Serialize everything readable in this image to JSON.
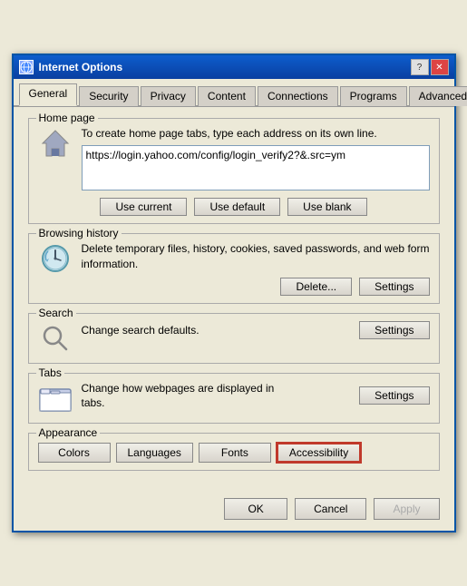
{
  "window": {
    "title": "Internet Options",
    "icon": "IE"
  },
  "tabs": [
    {
      "label": "General",
      "active": true
    },
    {
      "label": "Security",
      "active": false
    },
    {
      "label": "Privacy",
      "active": false
    },
    {
      "label": "Content",
      "active": false
    },
    {
      "label": "Connections",
      "active": false
    },
    {
      "label": "Programs",
      "active": false
    },
    {
      "label": "Advanced",
      "active": false
    }
  ],
  "sections": {
    "homepage": {
      "label": "Home page",
      "description": "To create home page tabs, type each address on its own line.",
      "url": "https://login.yahoo.com/config/login_verify2?&.src=ym",
      "buttons": {
        "use_current": "Use current",
        "use_default": "Use default",
        "use_blank": "Use blank"
      }
    },
    "browsing_history": {
      "label": "Browsing history",
      "description": "Delete temporary files, history, cookies, saved passwords, and web form information.",
      "buttons": {
        "delete": "Delete...",
        "settings": "Settings"
      }
    },
    "search": {
      "label": "Search",
      "description": "Change search defaults.",
      "buttons": {
        "settings": "Settings"
      }
    },
    "tabs": {
      "label": "Tabs",
      "description": "Change how webpages are displayed in tabs.",
      "buttons": {
        "settings": "Settings"
      }
    },
    "appearance": {
      "label": "Appearance",
      "buttons": {
        "colors": "Colors",
        "languages": "Languages",
        "fonts": "Fonts",
        "accessibility": "Accessibility"
      }
    }
  },
  "footer": {
    "ok": "OK",
    "cancel": "Cancel",
    "apply": "Apply"
  }
}
